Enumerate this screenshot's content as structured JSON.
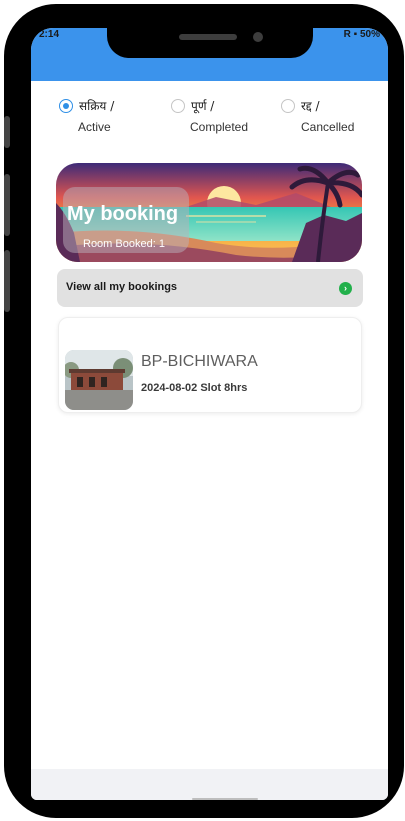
{
  "status_bar": {
    "time": "2:14",
    "battery": "R ▪ 50%"
  },
  "filters": {
    "options": [
      {
        "hindi": "सक्रिय /",
        "english": "Active",
        "selected": true
      },
      {
        "hindi": "पूर्ण /",
        "english": "Completed",
        "selected": false
      },
      {
        "hindi": "रद्द /",
        "english": "Cancelled",
        "selected": false
      }
    ]
  },
  "banner": {
    "title": "My booking",
    "subtitle": "Room Booked: 1"
  },
  "view_all": {
    "label": "View all my bookings",
    "icon": "chevron-right-icon"
  },
  "bookings": [
    {
      "name": "BP-BICHIWARA",
      "meta": "2024-08-02 Slot 8hrs"
    }
  ],
  "colors": {
    "app_bar": "#3b93ec",
    "radio_active": "#2f8fe6",
    "go_icon": "#22b04b"
  }
}
